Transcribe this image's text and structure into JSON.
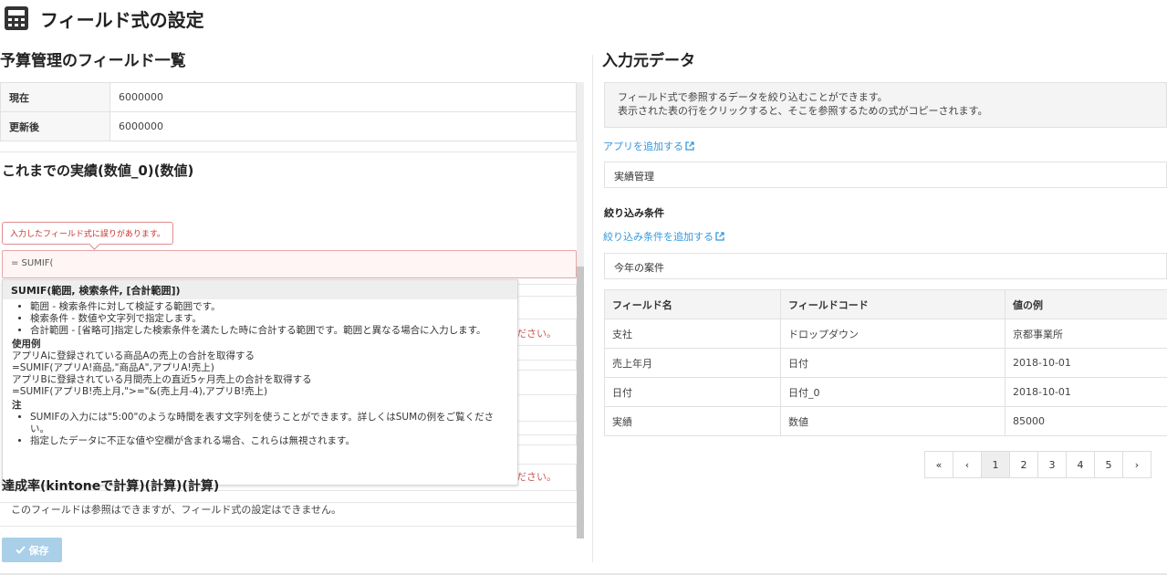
{
  "header": {
    "title": "フィールド式の設定",
    "icon": "calculator-icon"
  },
  "left": {
    "section_title": "予算管理のフィールド一覧",
    "kv_rows": [
      {
        "key": "現在",
        "value": "6000000"
      },
      {
        "key": "更新後",
        "value": "6000000"
      }
    ],
    "field_title": "これまでの実績(数値_0)(数値)",
    "error_tip": "入力したフィールド式に誤りがあります。",
    "formula_value": "= SUMIF(",
    "ghost_error_1": "ださい。",
    "ghost_error_2": "ださい。",
    "autocomplete": {
      "signature": "SUMIF(範囲, 検索条件, [合計範囲])",
      "params": [
        "範囲 - 検索条件に対して検証する範囲です。",
        "検索条件 - 数値や文字列で指定します。",
        "合計範囲 - [省略可]指定した検索条件を満たした時に合計する範囲です。範囲と異なる場合に入力します。"
      ],
      "example_heading": "使用例",
      "examples": [
        "アプリAに登録されている商品Aの売上の合計を取得する",
        "=SUMIF(アプリA!商品,\"商品A\",アプリA!売上)",
        "アプリBに登録されている月間売上の直近5ヶ月売上の合計を取得する",
        "=SUMIF(アプリB!売上月,\">=\"&(売上月-4),アプリB!売上)"
      ],
      "note_heading": "注",
      "notes": [
        "SUMIFの入力には\"5:00\"のような時間を表す文字列を使うことができます。詳しくはSUMの例をご覧ください。",
        "指定したデータに不正な値や空欄が含まれる場合、これらは無視されます。"
      ]
    },
    "achievement_title": "達成率(kintoneで計算)(計算)(計算)",
    "achievement_note": "このフィールドは参照はできますが、フィールド式の設定はできません。",
    "save_label": "保存"
  },
  "right": {
    "section_title": "入力元データ",
    "info_lines": [
      "フィールド式で参照するデータを絞り込むことができます。",
      "表示された表の行をクリックすると、そこを参照するための式がコピーされます。"
    ],
    "add_app_link": "アプリを追加する",
    "app_select": "実績管理",
    "filter_title": "絞り込み条件",
    "add_filter_link": "絞り込み条件を追加する",
    "filter_select": "今年の案件",
    "table_headers": [
      "フィールド名",
      "フィールドコード",
      "値の例"
    ],
    "table_rows": [
      [
        "支社",
        "ドロップダウン",
        "京都事業所"
      ],
      [
        "売上年月",
        "日付",
        "2018-10-01"
      ],
      [
        "日付",
        "日付_0",
        "2018-10-01"
      ],
      [
        "実績",
        "数値",
        "85000"
      ]
    ],
    "pager": [
      "«",
      "‹",
      "1",
      "2",
      "3",
      "4",
      "5",
      "›"
    ]
  },
  "colors": {
    "link": "#3498db",
    "error": "#cc3333",
    "save_button": "#a9cfe9"
  }
}
